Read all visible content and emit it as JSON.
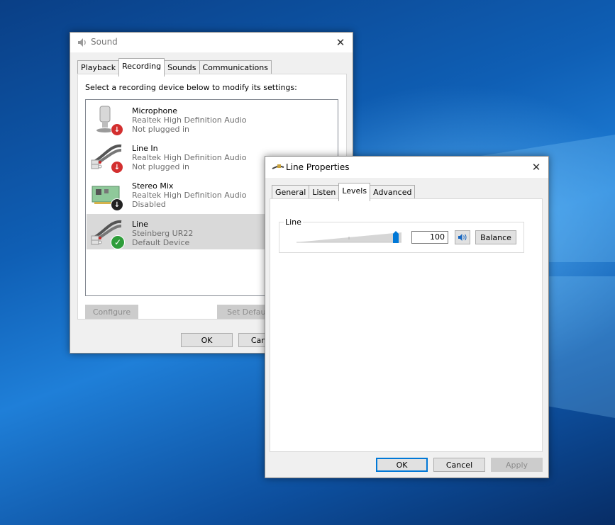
{
  "sound_window": {
    "title": "Sound",
    "close_glyph": "✕",
    "tabs": [
      {
        "label": "Playback"
      },
      {
        "label": "Recording"
      },
      {
        "label": "Sounds"
      },
      {
        "label": "Communications"
      }
    ],
    "instruction": "Select a recording device below to modify its settings:",
    "devices": [
      {
        "name": "Microphone",
        "driver": "Realtek High Definition Audio",
        "status": "Not plugged in",
        "icon": "microphone-icon",
        "badge": "unplugged-arrow"
      },
      {
        "name": "Line In",
        "driver": "Realtek High Definition Audio",
        "status": "Not plugged in",
        "icon": "rca-cable-icon",
        "badge": "unplugged-arrow"
      },
      {
        "name": "Stereo Mix",
        "driver": "Realtek High Definition Audio",
        "status": "Disabled",
        "icon": "sound-card-icon",
        "badge": "disabled-arrow"
      },
      {
        "name": "Line",
        "driver": "Steinberg UR22",
        "status": "Default Device",
        "icon": "rca-cable-icon",
        "badge": "default-check"
      }
    ],
    "buttons": {
      "configure": "Configure",
      "set_default": "Set Default",
      "ok": "OK",
      "cancel": "Cancel"
    }
  },
  "properties_window": {
    "title": "Line Properties",
    "close_glyph": "✕",
    "tabs": [
      {
        "label": "General"
      },
      {
        "label": "Listen"
      },
      {
        "label": "Levels"
      },
      {
        "label": "Advanced"
      }
    ],
    "active_tab": "Levels",
    "level_group_label": "Line",
    "level_value": "100",
    "level_fraction": 1.0,
    "balance_label": "Balance",
    "buttons": {
      "ok": "OK",
      "cancel": "Cancel",
      "apply": "Apply"
    }
  },
  "colors": {
    "accent": "#0078d7",
    "selection": "#d9d9d9",
    "unplugged_badge": "#d32f2f",
    "default_badge": "#2e9d3a",
    "disabled_badge": "#222222"
  }
}
